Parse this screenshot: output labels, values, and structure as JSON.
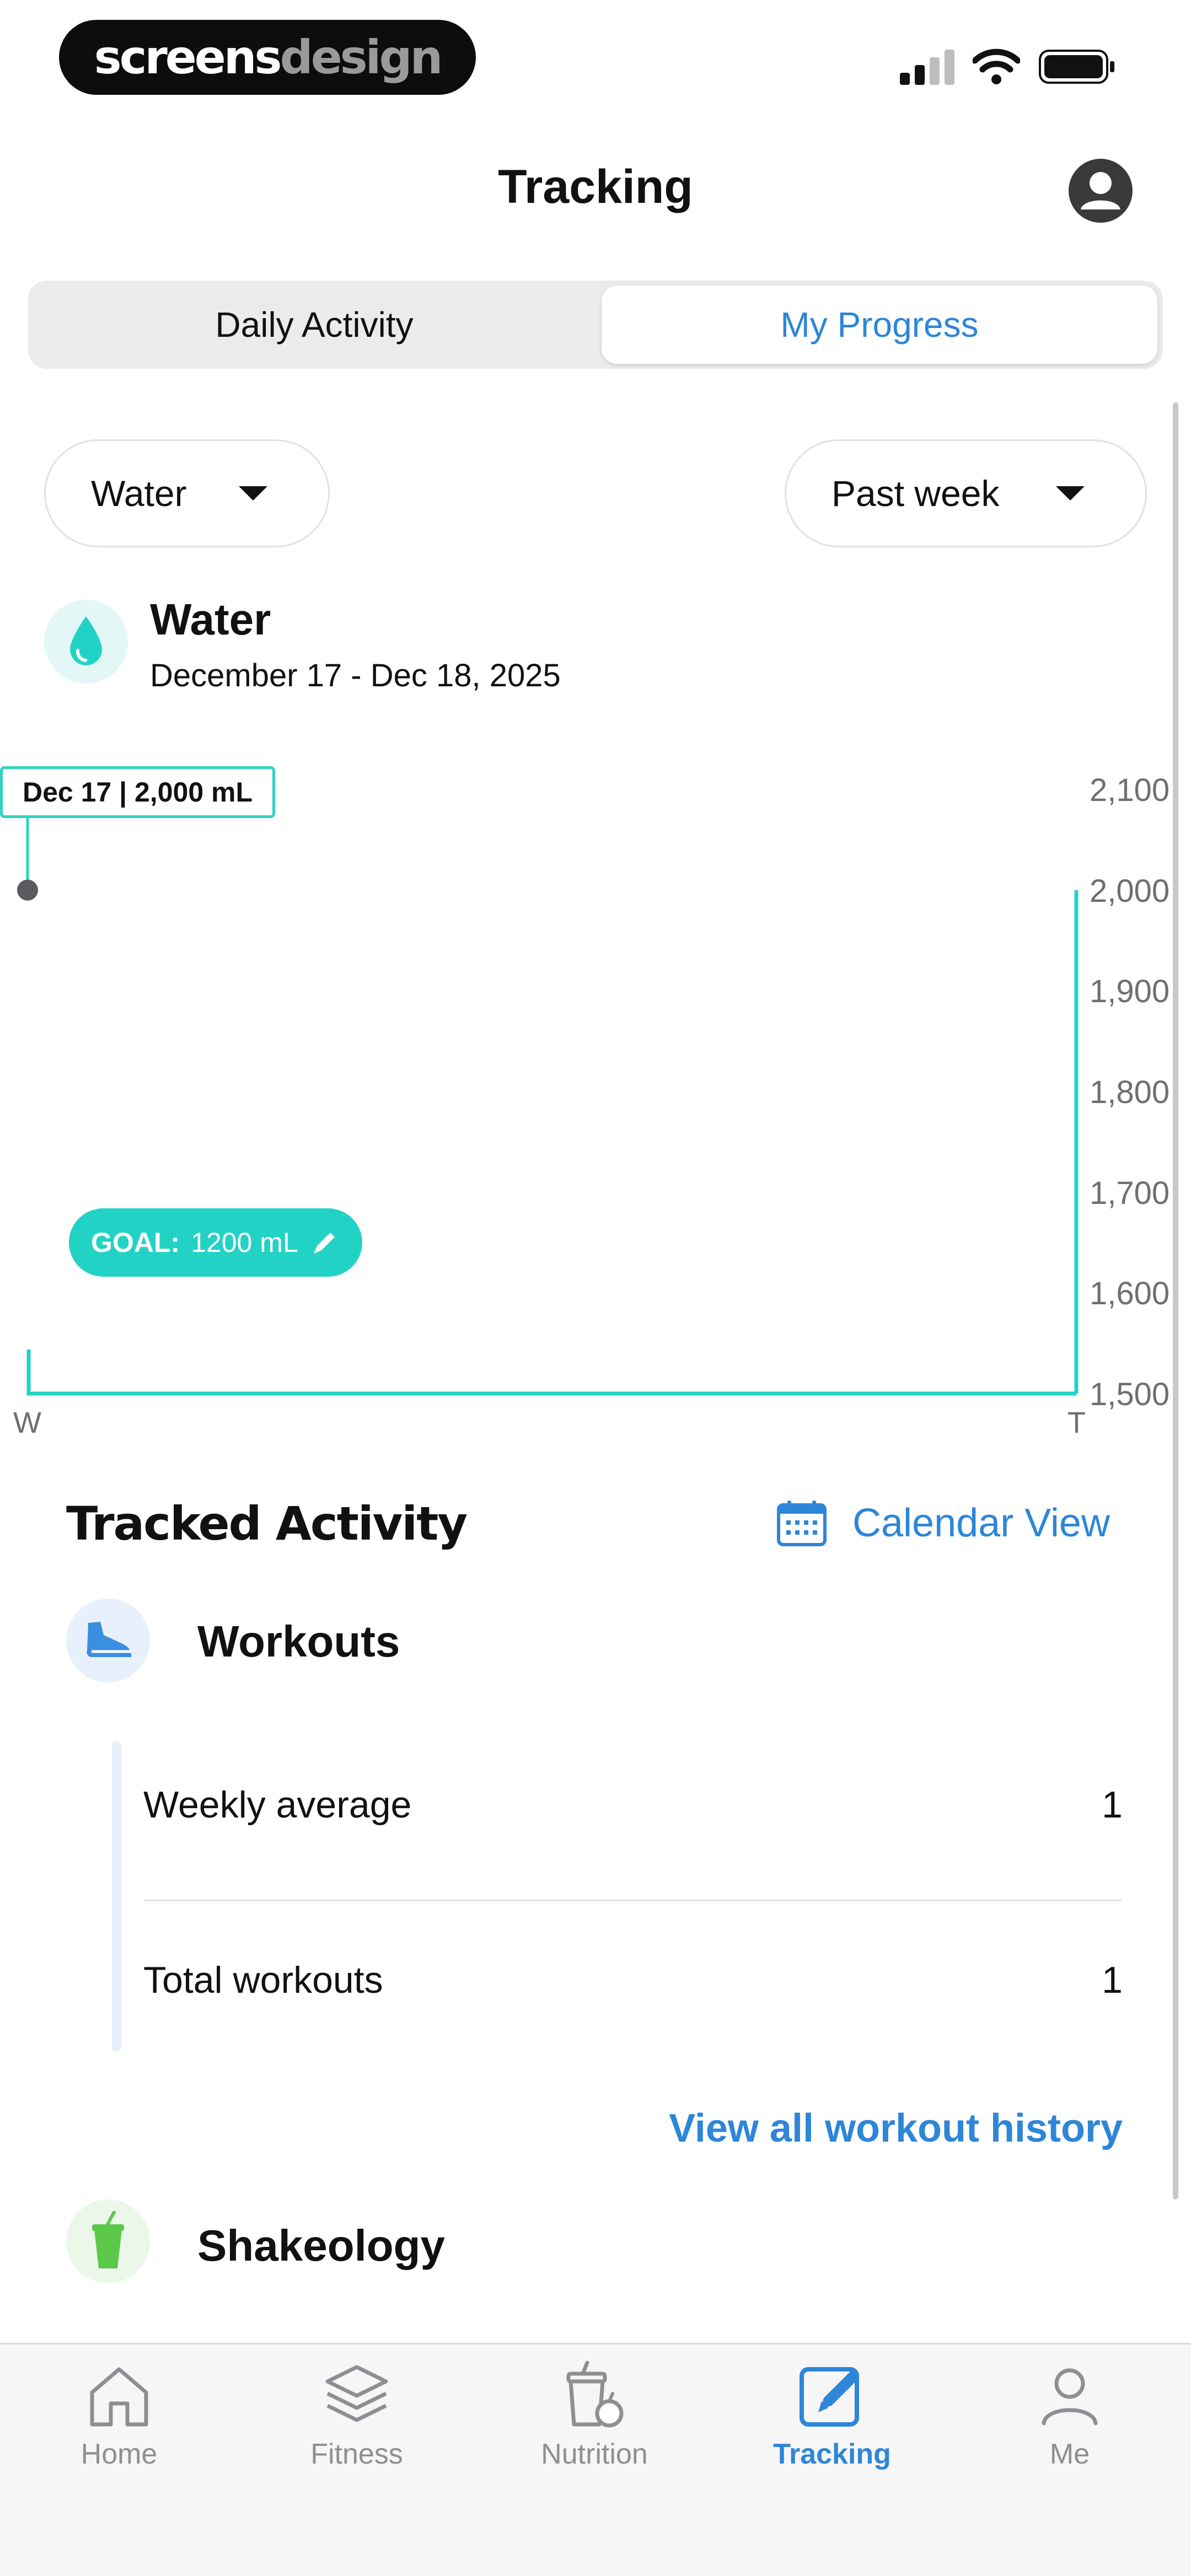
{
  "status_bar": {
    "brand_part1": "screens",
    "brand_part2": "design"
  },
  "header": {
    "title": "Tracking",
    "avatar_icon": "person-icon"
  },
  "tabs": [
    {
      "label": "Daily Activity",
      "selected": false
    },
    {
      "label": "My Progress",
      "selected": true
    }
  ],
  "filters": {
    "metric": "Water",
    "period": "Past week"
  },
  "metric": {
    "name": "Water",
    "date_range": "December 17 - Dec 18, 2025",
    "icon": "water-drop-icon"
  },
  "chart_data": {
    "type": "line",
    "x": [
      "W",
      "T"
    ],
    "series": [
      {
        "values": [
          2000,
          2000
        ]
      }
    ],
    "y_ticks": [
      "2,100",
      "2,000",
      "1,900",
      "1,800",
      "1,700",
      "1,600",
      "1,500"
    ],
    "ylim": [
      1500,
      2100
    ],
    "tooltip": "Dec 17 | 2,000 mL",
    "goal_label": "GOAL:",
    "goal_value": "1200 mL"
  },
  "tracked_activity": {
    "title": "Tracked Activity",
    "calendar_link": "Calendar View",
    "workouts": {
      "name": "Workouts",
      "stats": [
        {
          "label": "Weekly average",
          "value": "1"
        },
        {
          "label": "Total workouts",
          "value": "1"
        }
      ],
      "history_link": "View all workout history"
    },
    "shakeology": {
      "name": "Shakeology"
    }
  },
  "bottom_nav": [
    {
      "label": "Home",
      "icon": "home-icon"
    },
    {
      "label": "Fitness",
      "icon": "layers-icon"
    },
    {
      "label": "Nutrition",
      "icon": "nutrition-icon"
    },
    {
      "label": "Tracking",
      "icon": "edit-icon",
      "active": true
    },
    {
      "label": "Me",
      "icon": "person-icon"
    }
  ],
  "colors": {
    "accent": "#2d86d8",
    "teal": "#22d3c5"
  }
}
